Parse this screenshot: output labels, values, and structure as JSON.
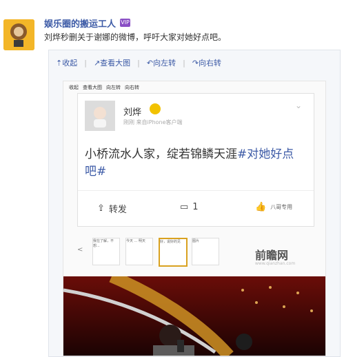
{
  "post": {
    "author": "娱乐圈的搬运工人",
    "badge": "VIP",
    "text": "刘烨秒删关于谢娜的微博，呼吁大家对她好点吧。"
  },
  "toolbar": {
    "collapse": "收起",
    "view_large": "查看大图",
    "rotate_left": "向左转",
    "rotate_right": "向右转"
  },
  "screenshot": {
    "mini_toolbar": {
      "collapse": "收起",
      "view_large": "查看大图",
      "rotate_left": "向左转",
      "rotate_right": "向右转"
    },
    "card": {
      "name": "刘烨",
      "source": "刚刚 来自iPhone客户端",
      "text_main": "小桥流水人家，绽若锦鳞天涯",
      "text_tag": "#对她好点吧#",
      "repost": "转发",
      "comment_count": "1",
      "like_label": "八哥专用"
    },
    "thumbnails": [
      {
        "text": "我在了解，不想..."
      },
      {
        "text": "今天 ... 明天"
      },
      {
        "text": "好，说好的见"
      },
      {
        "text": "图片"
      }
    ],
    "brand": "前瞻网",
    "brand_url": "www.qianzhan.com"
  },
  "colors": {
    "link": "#3c5aa6",
    "accent": "#d9a11f"
  }
}
